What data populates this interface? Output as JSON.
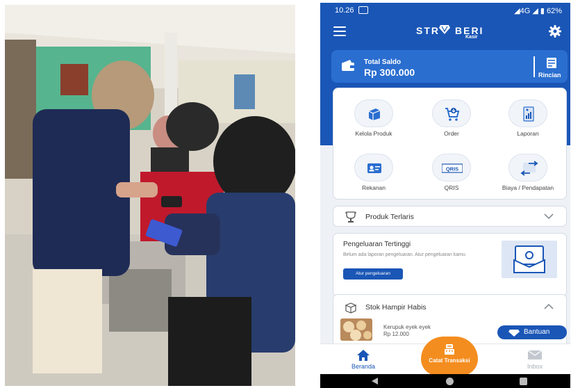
{
  "status_bar": {
    "time": "10.26",
    "right": "◢4G ◢ ▮ 62%"
  },
  "brand": {
    "name_left": "STR",
    "name_right": "BERI",
    "sub": "Kasir"
  },
  "saldo": {
    "label": "Total Saldo",
    "value": "Rp 300.000",
    "detail_label": "Rincian"
  },
  "menu": [
    {
      "label": "Kelola Produk",
      "icon": "box-icon"
    },
    {
      "label": "Order",
      "icon": "cart-icon"
    },
    {
      "label": "Laporan",
      "icon": "report-icon"
    },
    {
      "label": "Rekanan",
      "icon": "contact-card-icon"
    },
    {
      "label": "QRIS",
      "icon": "qris-icon",
      "badge": "QRIS"
    },
    {
      "label": "Biaya / Pendapatan",
      "icon": "exchange-icon"
    }
  ],
  "produk_terlaris": {
    "title": "Produk Terlaris"
  },
  "pengeluaran": {
    "title": "Pengeluaran Tertinggi",
    "description": "Belum ada laporan pengeluaran. Atur pengeluaran kamu",
    "button": "Atur pengeluaran"
  },
  "stok": {
    "title": "Stok Hampir Habis",
    "item_name": "Kerupuk eyek eyek",
    "item_price": "Rp 12.000"
  },
  "help_button": "Bantuan",
  "bottom_nav": {
    "home": "Beranda",
    "center": "Catat Transaksi",
    "inbox": "Inbox"
  },
  "colors": {
    "primary": "#1a56b6",
    "accent": "#f48d1f",
    "card": "#ffffff"
  }
}
